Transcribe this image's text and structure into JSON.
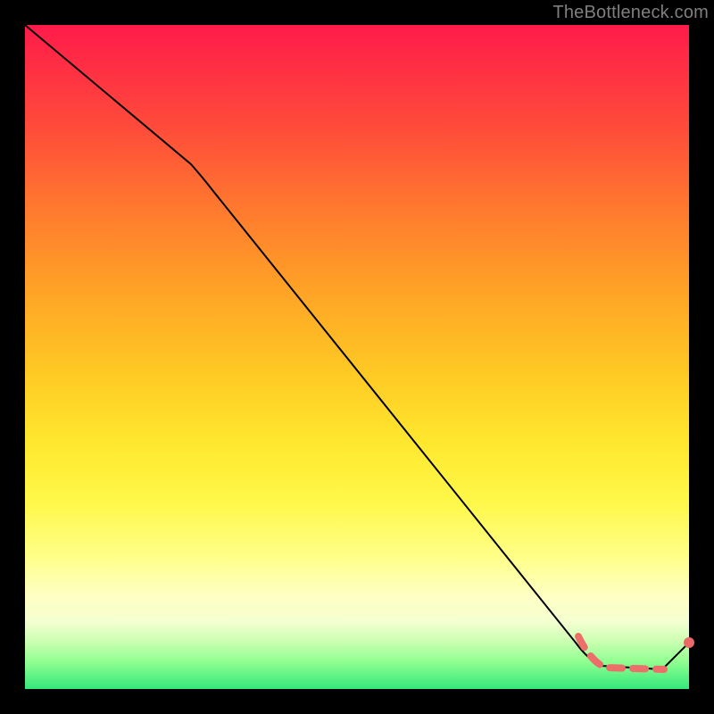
{
  "watermark": "TheBottleneck.com",
  "chart_data": {
    "type": "line",
    "title": "",
    "xlabel": "",
    "ylabel": "",
    "xlim": [
      0,
      100
    ],
    "ylim": [
      0,
      100
    ],
    "grid": false,
    "series": [
      {
        "name": "curve",
        "style": "solid-black",
        "points": [
          {
            "x": 0,
            "y": 100
          },
          {
            "x": 25,
            "y": 79
          },
          {
            "x": 83,
            "y": 7
          },
          {
            "x": 86,
            "y": 3
          },
          {
            "x": 96,
            "y": 3
          },
          {
            "x": 100,
            "y": 7
          }
        ]
      },
      {
        "name": "highlight-dashed",
        "style": "dashed-salmon",
        "points": [
          {
            "x": 83.5,
            "y": 8
          },
          {
            "x": 86,
            "y": 3.5
          },
          {
            "x": 88,
            "y": 3
          },
          {
            "x": 91,
            "y": 3
          },
          {
            "x": 94,
            "y": 3
          },
          {
            "x": 96,
            "y": 3
          }
        ]
      },
      {
        "name": "endpoint-marker",
        "style": "dot-salmon",
        "points": [
          {
            "x": 100,
            "y": 7
          }
        ]
      }
    ],
    "colors": {
      "curve": "#000000",
      "highlight": "#ed6f6a",
      "marker": "#e96a66"
    }
  }
}
